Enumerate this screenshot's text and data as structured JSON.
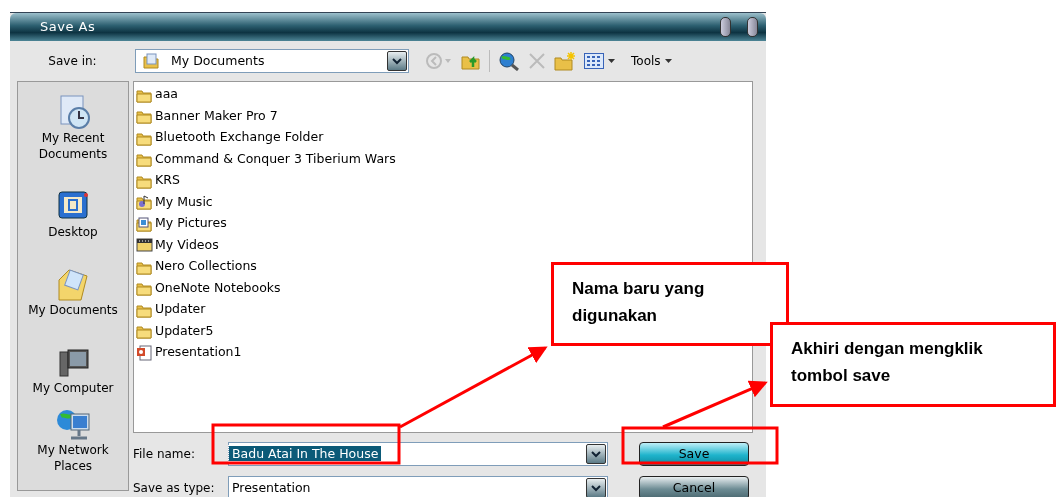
{
  "window": {
    "title": "Save As"
  },
  "toolbar": {
    "save_in_label": "Save in:",
    "location": "My Documents",
    "tools_label": "Tools"
  },
  "places": [
    {
      "label": "My Recent Documents",
      "kind": "recent"
    },
    {
      "label": "Desktop",
      "kind": "desktop"
    },
    {
      "label": "My Documents",
      "kind": "documents"
    },
    {
      "label": "My Computer",
      "kind": "computer"
    },
    {
      "label": "My Network Places",
      "kind": "network"
    }
  ],
  "files": [
    {
      "name": "aaa",
      "kind": "folder"
    },
    {
      "name": "Banner Maker Pro 7",
      "kind": "folder"
    },
    {
      "name": "Bluetooth Exchange Folder",
      "kind": "folder"
    },
    {
      "name": "Command & Conquer 3 Tiberium Wars",
      "kind": "folder"
    },
    {
      "name": "KRS",
      "kind": "folder"
    },
    {
      "name": "My Music",
      "kind": "music"
    },
    {
      "name": "My Pictures",
      "kind": "pictures"
    },
    {
      "name": "My Videos",
      "kind": "videos"
    },
    {
      "name": "Nero Collections",
      "kind": "folder"
    },
    {
      "name": "OneNote Notebooks",
      "kind": "folder"
    },
    {
      "name": "Updater",
      "kind": "folder"
    },
    {
      "name": "Updater5",
      "kind": "folder"
    },
    {
      "name": "Presentation1",
      "kind": "presentation"
    }
  ],
  "file_name": {
    "label": "File name:",
    "value": "Badu Atai In The House",
    "selected": true
  },
  "save_as_type": {
    "label": "Save as type:",
    "value": "Presentation"
  },
  "buttons": [
    {
      "label": "Save",
      "default": true
    },
    {
      "label": "Cancel",
      "default": false
    }
  ],
  "annotations": [
    {
      "text": "Nama baru yang digunakan"
    },
    {
      "text": "Akhiri dengan mengklik tombol save"
    }
  ]
}
